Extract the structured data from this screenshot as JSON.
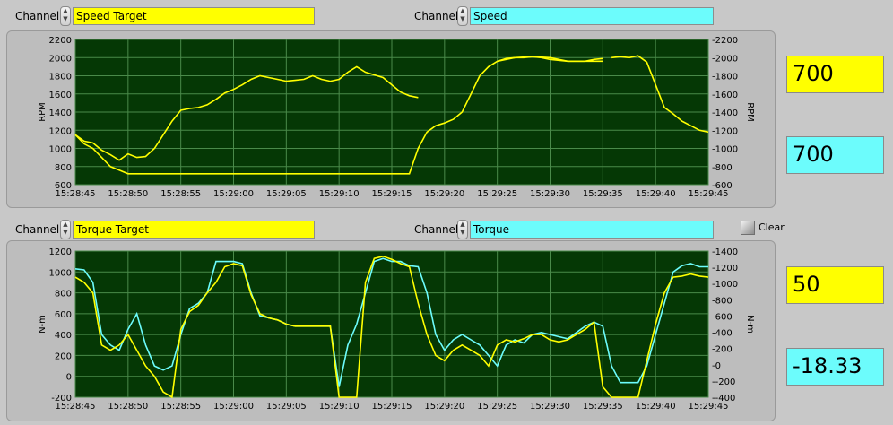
{
  "colors": {
    "yellow": "#ffff00",
    "cyan": "#6cfcfc",
    "plot_bg": "#053805",
    "grid": "#4a8a4a"
  },
  "top": {
    "channel_label_left": "Channel",
    "channel_value_left": "Speed Target",
    "channel_label_right": "Channel",
    "channel_value_right": "Speed"
  },
  "bottom": {
    "channel_label_left": "Channel",
    "channel_value_left": "Torque Target",
    "channel_label_right": "Channel",
    "channel_value_right": "Torque",
    "clear_label": "Clear"
  },
  "indicators": {
    "speed_target": "700",
    "speed": "700",
    "torque_target": "50",
    "torque": "-18.33"
  },
  "chart_data": [
    {
      "type": "line",
      "ylabel": "RPM",
      "y2label": "RPM",
      "ylim": [
        600,
        2200
      ],
      "y_ticks": [
        "600",
        "800",
        "1000",
        "1200",
        "1400",
        "1600",
        "1800",
        "2000",
        "2200"
      ],
      "x_ticks": [
        "15:28:45",
        "15:28:50",
        "15:28:55",
        "15:29:00",
        "15:29:05",
        "15:29:10",
        "15:29:15",
        "15:29:20",
        "15:29:25",
        "15:29:30",
        "15:29:35",
        "15:29:40",
        "15:29:45"
      ],
      "series": [
        {
          "color": "yellow",
          "t": [
            0,
            1,
            2,
            3,
            4,
            5,
            6,
            7,
            8,
            9,
            10,
            11,
            12,
            13,
            14,
            15,
            16,
            17,
            18,
            19,
            20,
            21,
            22,
            23,
            24,
            25,
            26,
            27,
            28,
            29,
            30,
            31,
            32,
            33,
            34,
            35,
            36,
            37,
            38,
            39,
            40,
            41,
            42
          ],
          "values": [
            1150,
            1080,
            1060,
            980,
            930,
            870,
            940,
            900,
            910,
            1000,
            1150,
            1300,
            1420,
            1440,
            1450,
            1480,
            1540,
            1610,
            1650,
            1700,
            1760,
            1800,
            1780,
            1760,
            1740,
            1750,
            1760,
            1800,
            1760,
            1740,
            1760,
            1840,
            1900,
            1840,
            1810,
            1780,
            1700,
            1620,
            1580,
            1560,
            null,
            null,
            null
          ]
        },
        {
          "color": "yellow",
          "t": [
            0,
            1,
            2,
            3,
            4,
            5,
            6,
            7,
            8,
            9,
            10,
            11,
            12,
            13,
            14,
            15,
            16,
            17,
            18,
            19,
            20,
            21,
            22,
            23,
            24,
            25,
            26,
            27,
            28,
            29,
            30,
            31,
            32,
            33,
            34,
            35,
            36,
            37,
            38,
            39,
            40,
            41,
            42,
            43,
            44,
            45,
            46,
            47,
            48,
            49,
            50,
            51,
            52,
            53,
            54,
            55,
            56,
            57,
            58,
            59,
            60
          ],
          "values": [
            1150,
            1050,
            1000,
            900,
            800,
            760,
            720,
            720,
            720,
            720,
            720,
            720,
            720,
            720,
            720,
            720,
            720,
            720,
            720,
            720,
            720,
            720,
            720,
            720,
            720,
            720,
            720,
            720,
            720,
            720,
            720,
            720,
            720,
            720,
            720,
            720,
            720,
            720,
            720,
            1000,
            1180,
            1250,
            1280,
            1320,
            1400,
            1600,
            1800,
            1900,
            1960,
            1990,
            2000,
            2000,
            2010,
            2000,
            1980,
            1970,
            1960,
            1960,
            1960,
            1980,
            1990
          ]
        },
        {
          "color": "yellow",
          "t": [
            48,
            50,
            52,
            54,
            56,
            58,
            60
          ],
          "values": [
            1960,
            2000,
            2010,
            2000,
            1960,
            1960,
            1960
          ]
        },
        {
          "color": "yellow",
          "t": [
            61,
            62,
            63,
            64,
            65,
            66,
            67,
            68,
            69,
            70,
            71,
            72
          ],
          "values": [
            2000,
            2010,
            2000,
            2020,
            1950,
            1700,
            1450,
            1380,
            1300,
            1250,
            1200,
            1180
          ]
        }
      ]
    },
    {
      "type": "line",
      "ylabel": "N-m",
      "y2label": "N-m",
      "ylim": [
        -200,
        1200
      ],
      "y2lim": [
        -400,
        1400
      ],
      "y_ticks": [
        "-200",
        "0",
        "200",
        "400",
        "600",
        "800",
        "1000",
        "1200"
      ],
      "y2_ticks": [
        "-400",
        "-200",
        "0",
        "200",
        "400",
        "600",
        "800",
        "1000",
        "1200",
        "1400"
      ],
      "x_ticks": [
        "15:28:45",
        "15:28:50",
        "15:28:55",
        "15:29:00",
        "15:29:05",
        "15:29:10",
        "15:29:15",
        "15:29:20",
        "15:29:25",
        "15:29:30",
        "15:29:35",
        "15:29:40",
        "15:29:45"
      ],
      "series": [
        {
          "color": "cyan",
          "t": [
            0,
            1,
            2,
            3,
            4,
            5,
            6,
            7,
            8,
            9,
            10,
            11,
            12,
            13,
            14,
            15,
            16,
            17,
            18,
            19,
            20,
            21,
            22,
            23,
            24,
            25,
            26,
            27,
            28,
            29,
            30,
            31,
            32,
            33,
            34,
            35,
            36,
            37,
            38,
            39,
            40,
            41,
            42,
            43,
            44,
            45,
            46,
            47,
            48,
            49,
            50,
            51,
            52,
            53,
            54,
            55,
            56,
            57,
            58,
            59,
            60,
            61,
            62,
            63,
            64,
            65,
            66,
            67,
            68,
            69,
            70,
            71,
            72
          ],
          "values": [
            1030,
            1020,
            900,
            400,
            300,
            250,
            450,
            600,
            300,
            100,
            60,
            100,
            400,
            650,
            700,
            800,
            1100,
            1100,
            1100,
            1080,
            800,
            580,
            560,
            540,
            500,
            480,
            480,
            480,
            480,
            480,
            -100,
            300,
            500,
            800,
            1100,
            1130,
            1100,
            1100,
            1060,
            1050,
            800,
            400,
            250,
            350,
            400,
            350,
            300,
            200,
            100,
            300,
            350,
            320,
            400,
            420,
            400,
            380,
            360,
            420,
            480,
            520,
            480,
            100,
            -60,
            -60,
            -60,
            100,
            400,
            700,
            1000,
            1060,
            1080,
            1050,
            1050
          ]
        },
        {
          "color": "yellow",
          "t": [
            0,
            1,
            2,
            3,
            4,
            5,
            6,
            7,
            8,
            9,
            10,
            11,
            12,
            13,
            14,
            15,
            16,
            17,
            18,
            19,
            20,
            21,
            22,
            23,
            24,
            25,
            26,
            27,
            28,
            29,
            30,
            31,
            32,
            33,
            34,
            35,
            36,
            37,
            38,
            39,
            40,
            41,
            42,
            43,
            44,
            45,
            46,
            47,
            48,
            49,
            50,
            51,
            52,
            53,
            54,
            55,
            56,
            57,
            58,
            59,
            60,
            61,
            62,
            63,
            64,
            65,
            66,
            67,
            68,
            69,
            70,
            71,
            72
          ],
          "values": [
            950,
            900,
            800,
            300,
            250,
            300,
            400,
            250,
            100,
            0,
            -150,
            -200,
            450,
            620,
            680,
            800,
            900,
            1050,
            1080,
            1060,
            780,
            600,
            560,
            540,
            500,
            480,
            480,
            480,
            480,
            480,
            -200,
            -200,
            -200,
            900,
            1130,
            1150,
            1120,
            1080,
            1050,
            700,
            400,
            200,
            150,
            250,
            300,
            250,
            200,
            100,
            300,
            350,
            330,
            360,
            400,
            400,
            350,
            330,
            350,
            400,
            450,
            520,
            -100,
            -200,
            -200,
            -200,
            -200,
            150,
            500,
            800,
            950,
            960,
            980,
            960,
            950
          ]
        }
      ]
    }
  ]
}
